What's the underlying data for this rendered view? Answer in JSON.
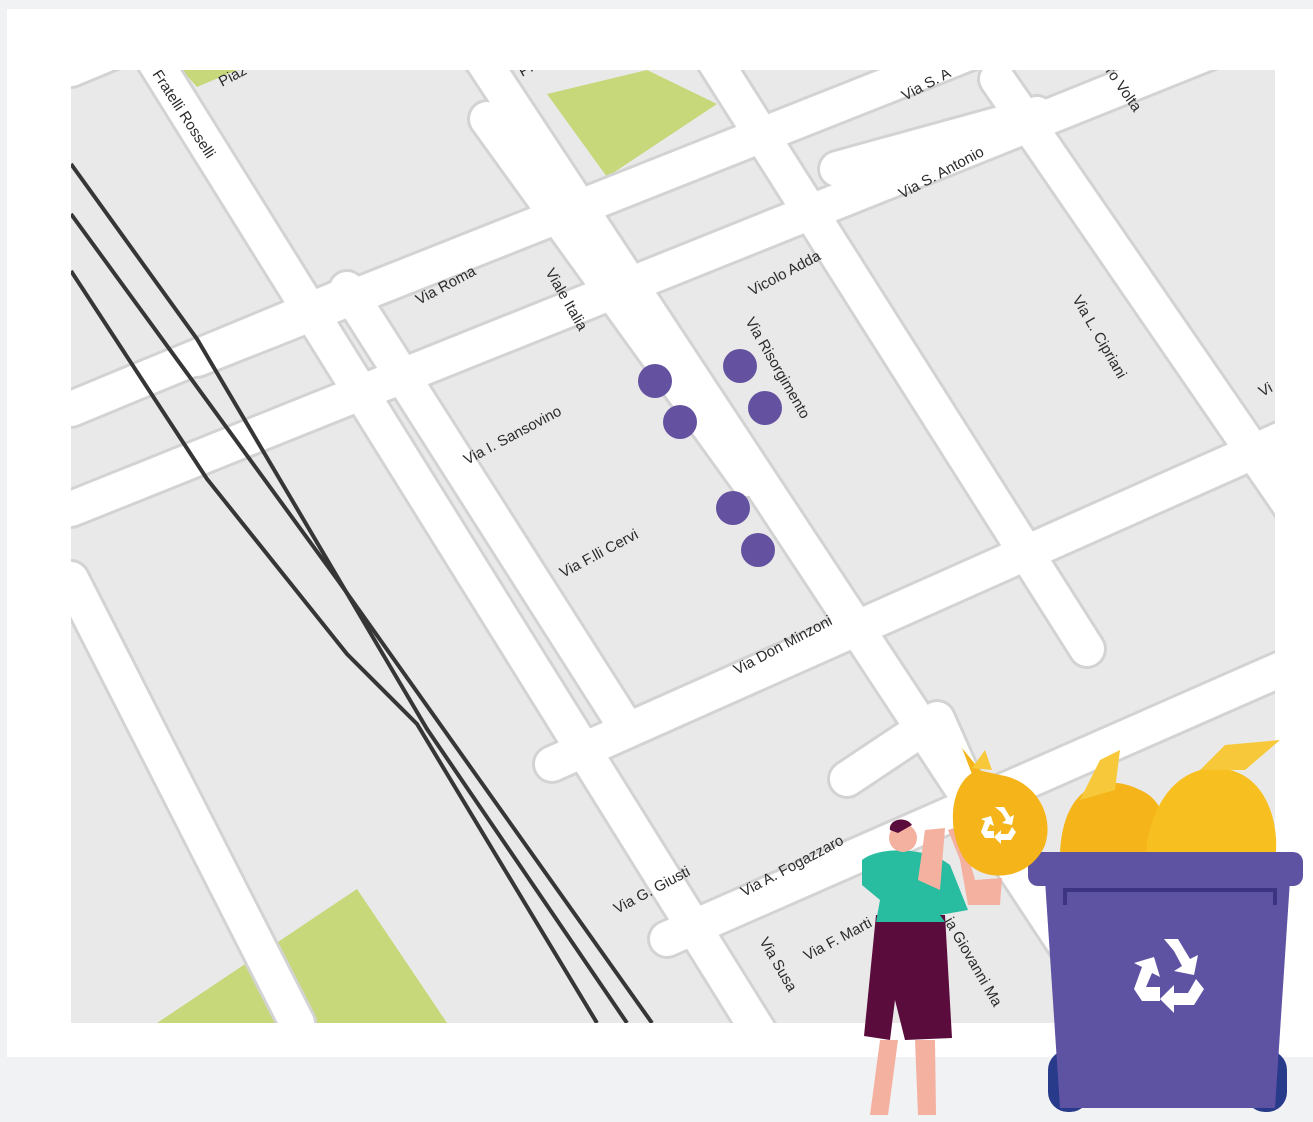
{
  "map": {
    "colors": {
      "block": "#e9e9e9",
      "block_outline": "#d3d3d3",
      "road": "#ffffff",
      "park": "#c6d87a",
      "railway": "#363636",
      "marker": "#6451a0",
      "bin": "#5e52a3",
      "bag": "#f7bf1f"
    },
    "streets": [
      {
        "name": "Fratelli Rosselli"
      },
      {
        "name": "Piaz"
      },
      {
        "name": "Pi"
      },
      {
        "name": "Via S. A"
      },
      {
        "name": "ro Volta"
      },
      {
        "name": "Via S. Antonio"
      },
      {
        "name": "Via Roma"
      },
      {
        "name": "Viale Italia"
      },
      {
        "name": "Vicolo Adda"
      },
      {
        "name": "Via Risorgimento"
      },
      {
        "name": "Via L. Cipriani"
      },
      {
        "name": "Vi"
      },
      {
        "name": "Via I. Sansovino"
      },
      {
        "name": "Via F.lli Cervi"
      },
      {
        "name": "Via Don Minzoni"
      },
      {
        "name": "Via G. Giusti"
      },
      {
        "name": "Via A. Fogazzaro"
      },
      {
        "name": "Via F. Marti"
      },
      {
        "name": "ia Giovanni Ma"
      },
      {
        "name": "Via Susa"
      }
    ],
    "markers": [
      {
        "name": "collection-point-1"
      },
      {
        "name": "collection-point-2"
      },
      {
        "name": "collection-point-3"
      },
      {
        "name": "collection-point-4"
      },
      {
        "name": "collection-point-5"
      },
      {
        "name": "collection-point-6"
      }
    ]
  },
  "illustration": {
    "icons": [
      "recycle-icon"
    ]
  }
}
